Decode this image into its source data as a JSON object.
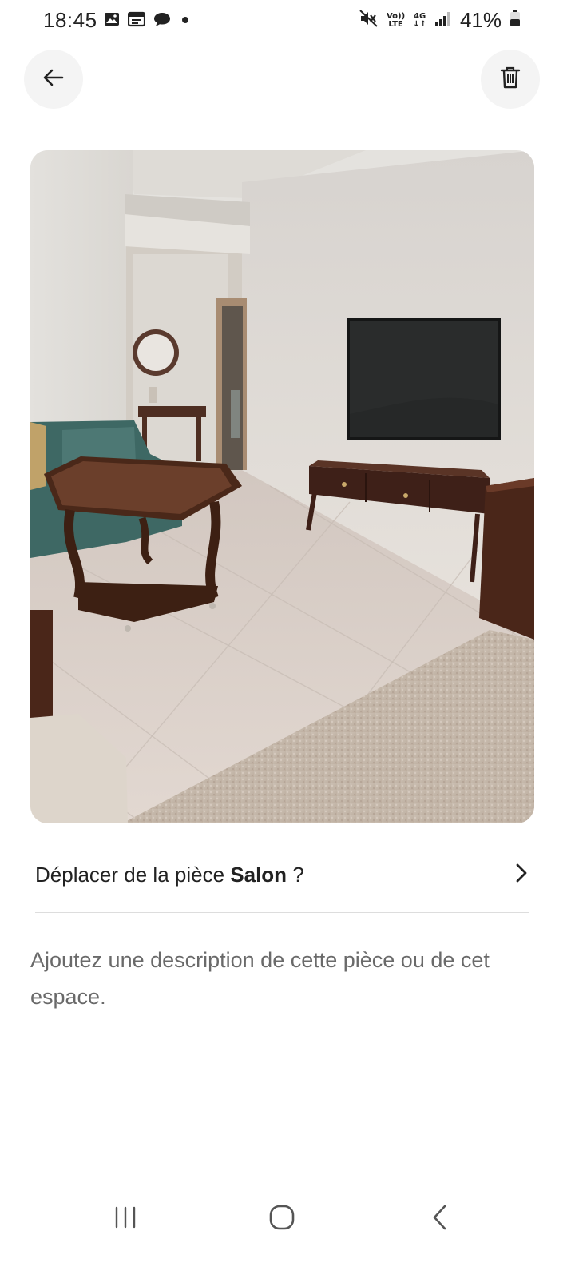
{
  "status_bar": {
    "time": "18:45",
    "battery": "41%",
    "volte_top": "Vo))",
    "volte_bottom": "LTE",
    "network_type": "4G",
    "left_icons": [
      "image-icon",
      "calendar-icon",
      "chat-bubble-icon",
      "dot-icon"
    ],
    "right_icons": [
      "mute-icon",
      "volte-icon",
      "4g-icon",
      "signal-icon",
      "battery-icon"
    ]
  },
  "header": {
    "back_icon": "arrow-left-icon",
    "delete_icon": "trash-icon"
  },
  "photo": {
    "subject": "living-room-photo"
  },
  "room_row": {
    "prefix": "Déplacer de la pièce ",
    "room_name": "Salon",
    "suffix": " ?",
    "chevron_icon": "chevron-right-icon"
  },
  "description": {
    "placeholder": "Ajoutez une description de cette pièce ou de cet espace."
  },
  "nav_bar": {
    "icons": [
      "recent-apps-icon",
      "home-icon",
      "back-icon"
    ]
  },
  "colors": {
    "text_primary": "#222222",
    "text_secondary": "#6a6a6a",
    "button_bg": "#f4f4f4",
    "divider": "#dddddd"
  }
}
